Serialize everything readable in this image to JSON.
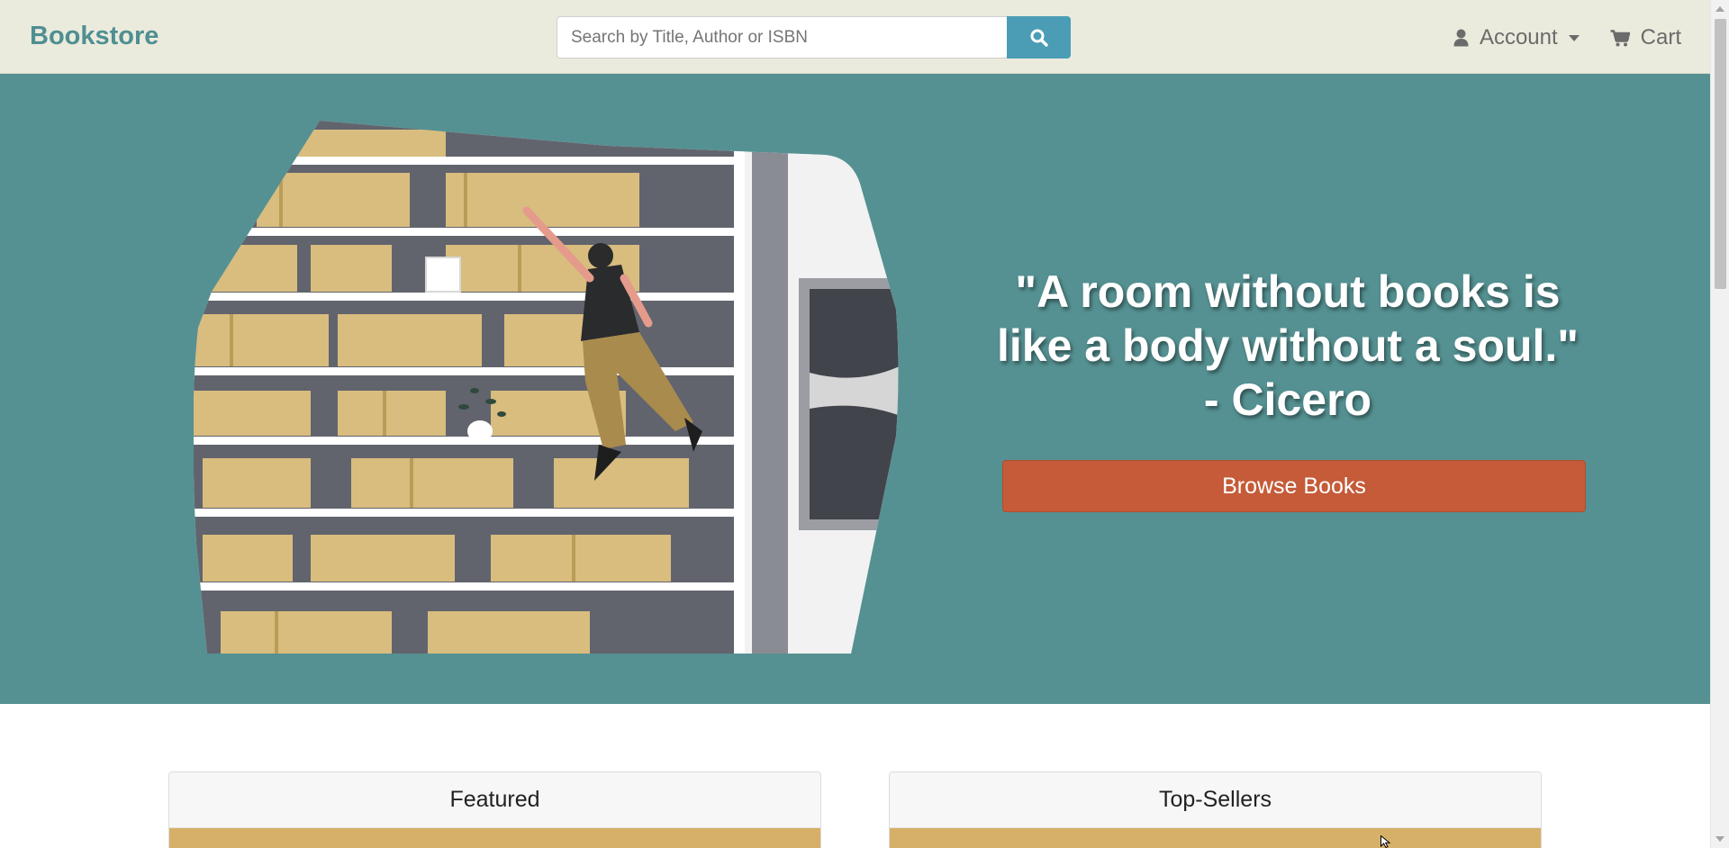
{
  "navbar": {
    "brand": "Bookstore",
    "search_placeholder": "Search by Title, Author or ISBN",
    "search_value": "",
    "account_label": "Account",
    "cart_label": "Cart"
  },
  "hero": {
    "quote_line1": "\"A room without books is",
    "quote_line2": "like a body without a soul.\"",
    "quote_line3": "- Cicero",
    "browse_button_label": "Browse Books"
  },
  "sections": {
    "featured_title": "Featured",
    "top_sellers_title": "Top-Sellers"
  },
  "colors": {
    "navbar_bg": "#ebebdd",
    "brand": "#4f8f92",
    "search_button": "#4a9db5",
    "hero_bg": "#559192",
    "browse_button": "#c55b39"
  },
  "icons": [
    "search-icon",
    "user-icon",
    "cart-icon",
    "caret-down-icon",
    "cursor-icon"
  ]
}
